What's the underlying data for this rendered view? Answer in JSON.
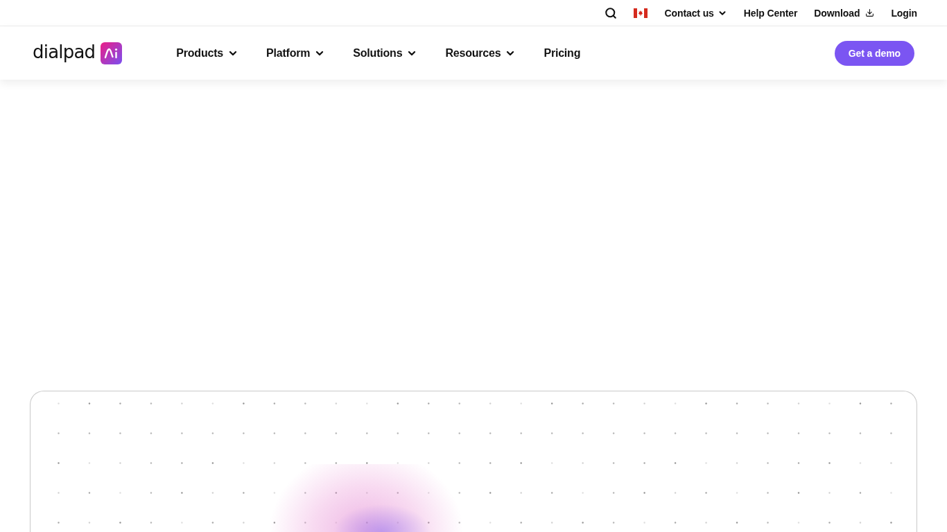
{
  "utility_bar": {
    "links": [
      {
        "label": "Contact us",
        "kind": "dropdown"
      },
      {
        "label": "Help Center",
        "kind": "link"
      },
      {
        "label": "Download",
        "kind": "download"
      },
      {
        "label": "Login",
        "kind": "link"
      }
    ]
  },
  "navbar": {
    "logo": {
      "text": "dialpad"
    },
    "menu": [
      {
        "label": "Products",
        "kind": "dropdown"
      },
      {
        "label": "Platform",
        "kind": "dropdown"
      },
      {
        "label": "Solutions",
        "kind": "dropdown"
      },
      {
        "label": "Resources",
        "kind": "dropdown"
      },
      {
        "label": "Pricing",
        "kind": "link"
      }
    ],
    "cta": {
      "label": "Get a demo"
    }
  }
}
